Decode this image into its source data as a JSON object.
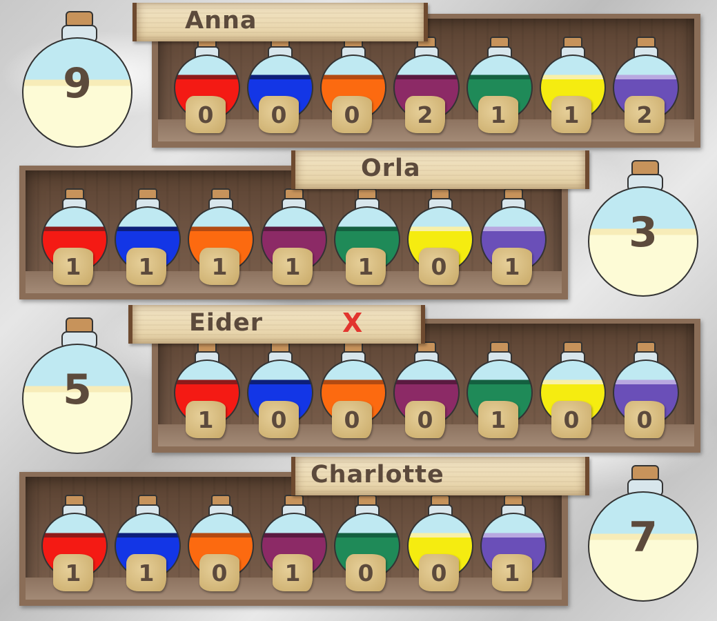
{
  "colors": {
    "potions": [
      "#f41a14",
      "#1336e6",
      "#fc6a10",
      "#8c2a66",
      "#1f8a58",
      "#f5ec10",
      "#6a4fb8"
    ],
    "potion_highlights": [
      "#8e1a1a",
      "#0d1f7a",
      "#b34a12",
      "#5a1a40",
      "#146040",
      "#f8f0a8",
      "#b8a8e0"
    ],
    "glass": "#bfe9f2",
    "text": "#5c4a3c",
    "x_mark": "#e2352e"
  },
  "players": [
    {
      "name": "Anna",
      "marker": "",
      "score": "9",
      "counts": [
        "0",
        "0",
        "0",
        "2",
        "1",
        "1",
        "2"
      ]
    },
    {
      "name": "Orla",
      "marker": "",
      "score": "3",
      "counts": [
        "1",
        "1",
        "1",
        "1",
        "1",
        "0",
        "1"
      ]
    },
    {
      "name": "Eider",
      "marker": "X",
      "score": "5",
      "counts": [
        "1",
        "0",
        "0",
        "0",
        "1",
        "0",
        "0"
      ]
    },
    {
      "name": "Charlotte",
      "marker": "",
      "score": "7",
      "counts": [
        "1",
        "1",
        "0",
        "1",
        "0",
        "0",
        "1"
      ]
    }
  ]
}
